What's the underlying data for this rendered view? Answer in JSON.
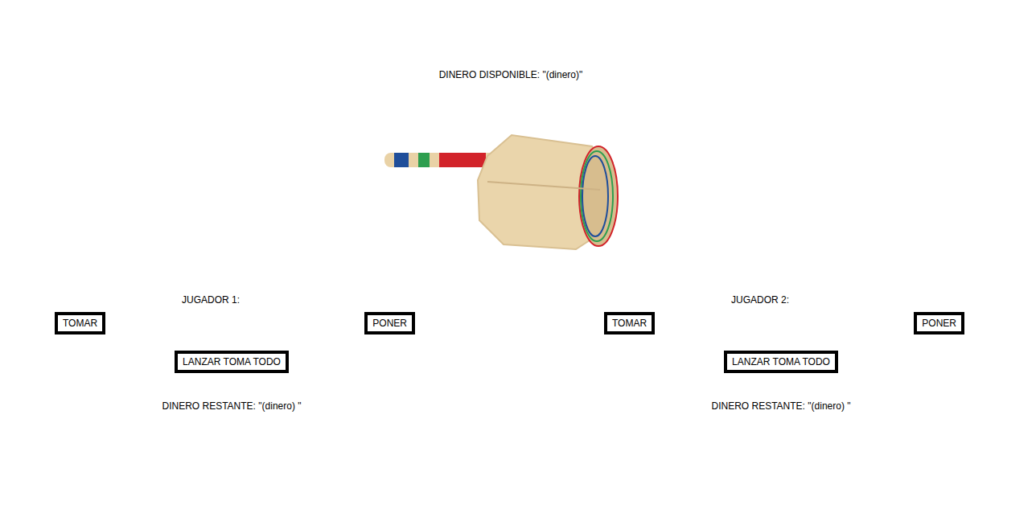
{
  "header": {
    "available": "DINERO DISPONIBLE: \"(dinero)\""
  },
  "players": [
    {
      "name": "JUGADOR 1:",
      "take": "TOMAR",
      "put": "PONER",
      "spin": "LANZAR TOMA TODO",
      "remaining": "DINERO RESTANTE: \"(dinero) \""
    },
    {
      "name": "JUGADOR 2:",
      "take": "TOMAR",
      "put": "PONER",
      "spin": "LANZAR TOMA TODO",
      "remaining": "DINERO RESTANTE: \"(dinero) \""
    }
  ]
}
